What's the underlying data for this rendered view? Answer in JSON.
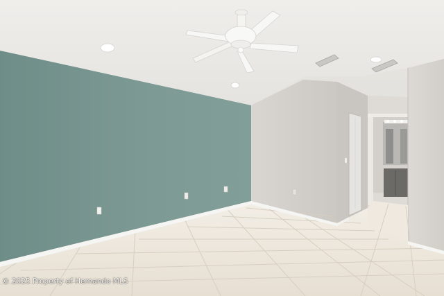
{
  "photo": {
    "subject": "empty-room-interior"
  },
  "watermark": {
    "text": "2025 Property of Hernando MLS"
  },
  "colors": {
    "accent_wall": "#7f9c96",
    "neutral_wall": "#d4d0cc",
    "ceiling": "#ecebe8",
    "tile_floor": "#ebe4d8",
    "baseboard": "#f7f7f5"
  }
}
